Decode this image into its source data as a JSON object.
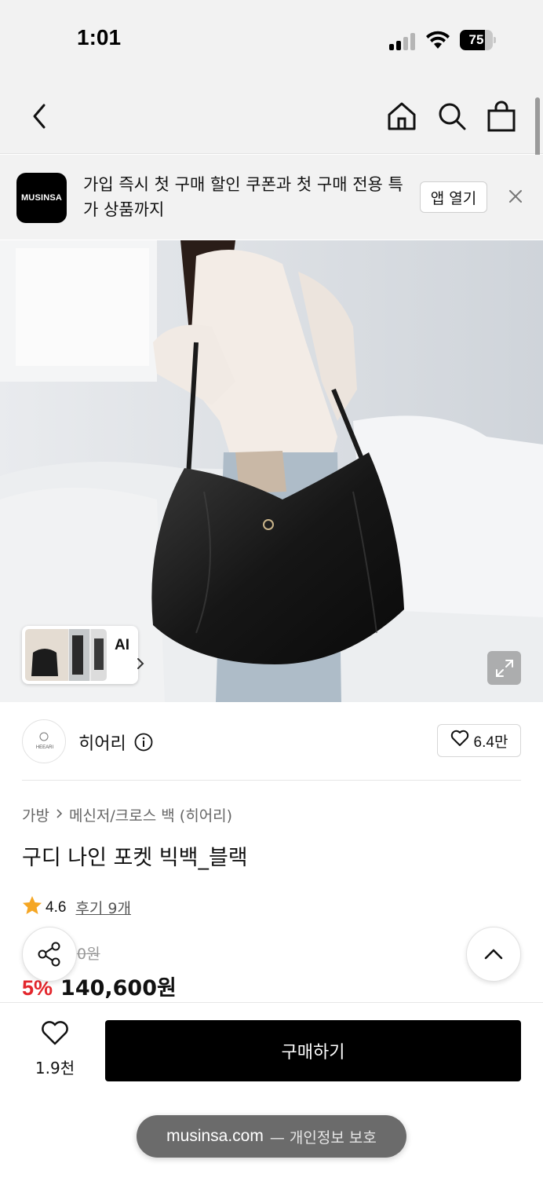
{
  "status_bar": {
    "time": "1:01",
    "battery_percent": "75",
    "battery_level": 0.75,
    "icons": [
      "signal-icon",
      "wifi-icon",
      "battery-icon"
    ]
  },
  "nav": {
    "icons": [
      "back-icon",
      "home-icon",
      "search-icon",
      "shopping-bag-icon"
    ]
  },
  "banner": {
    "logo_text": "MUSINSA",
    "message": "가입 즉시 첫 구매 할인 쿠폰과 첫 구매 전용 특가 상품까지",
    "open_app_label": "앱 열기"
  },
  "hero": {
    "thumbnail_label": "AI",
    "icons": [
      "chevron-right-icon",
      "expand-icon"
    ]
  },
  "brand": {
    "name": "히어리",
    "logo_text": "HEEARI",
    "like_count": "6.4만"
  },
  "product": {
    "breadcrumb": [
      "가방",
      "메신저/크로스 백 (히어리)"
    ],
    "title": "구디 나인 포켓 빅백_블랙",
    "rating": "4.6",
    "review_link": "후기 9개",
    "original_price": "0원",
    "discount": "5%",
    "price": "140,600원"
  },
  "bottom_bar": {
    "wish_count": "1.9천",
    "buy_label": "구매하기"
  },
  "browser": {
    "domain": "musinsa.com",
    "privacy_label": "— 개인정보 보호"
  },
  "colors": {
    "discount": "#e3262c",
    "buy_button": "#000000",
    "rating_star": "#f5a623"
  }
}
